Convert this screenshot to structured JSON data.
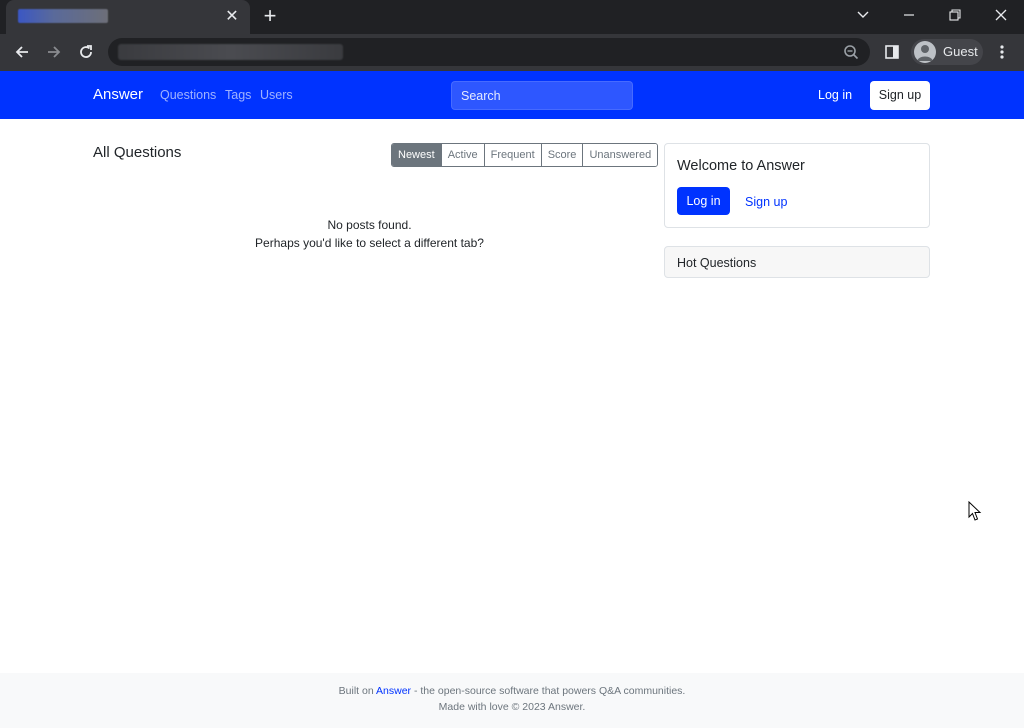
{
  "browser": {
    "close_tab_glyph": "✕",
    "new_tab_glyph": "+",
    "tab_search_glyph": "⌵",
    "minimize_glyph": "—",
    "restore_glyph": "❐",
    "close_window_glyph": "✕",
    "back_glyph": "←",
    "forward_glyph": "→",
    "reload_glyph": "↻",
    "menu_glyph": "⋮",
    "profile_label": "Guest"
  },
  "navbar": {
    "brand": "Answer",
    "links": [
      "Questions",
      "Tags",
      "Users"
    ],
    "search_placeholder": "Search",
    "login_label": "Log in",
    "signup_label": "Sign up",
    "color": "#0033ff"
  },
  "main": {
    "title": "All Questions",
    "sort_tabs": [
      "Newest",
      "Active",
      "Frequent",
      "Score",
      "Unanswered"
    ],
    "active_sort": "Newest",
    "empty_line1": "No posts found.",
    "empty_line2": "Perhaps you'd like to select a different tab?"
  },
  "sidebar": {
    "welcome_title": "Welcome to Answer",
    "login_label": "Log in",
    "signup_label": "Sign up",
    "hot_questions_title": "Hot Questions"
  },
  "footer": {
    "built_on_prefix": "Built on ",
    "built_on_link": "Answer",
    "built_on_suffix": " - the open-source software that powers Q&A communities.",
    "made_with": "Made with love © 2023 Answer."
  }
}
